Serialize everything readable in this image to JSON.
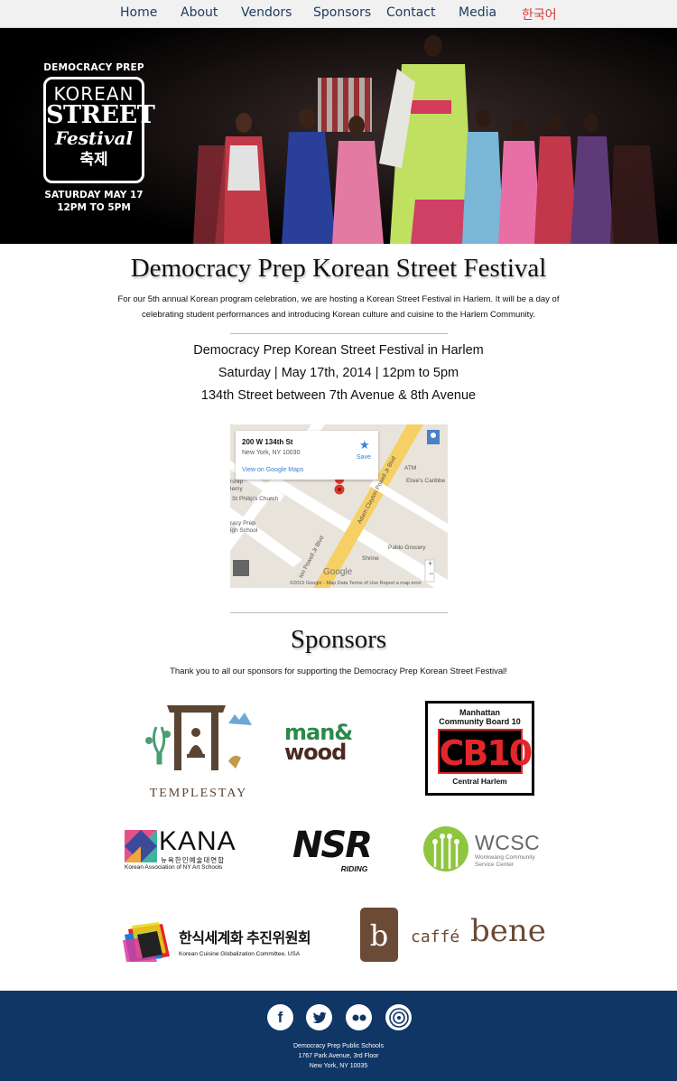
{
  "nav": {
    "items": [
      "Home",
      "About",
      "Vendors",
      "Sponsors",
      "Contact",
      "Media",
      "한국어"
    ]
  },
  "hero": {
    "logo_top": "DEMOCRACY PREP",
    "logo_line1": "KOREAN",
    "logo_line2": "STREET",
    "logo_line3": "Festival",
    "logo_line4": "축제",
    "logo_date": "SATURDAY  MAY  17",
    "logo_time": "12PM TO 5PM"
  },
  "main": {
    "title": "Democracy Prep Korean Street Festival",
    "intro": "For our 5th annual Korean program celebration, we are hosting a Korean Street Festival in Harlem. It will be a day of celebrating student performances and introducing Korean culture and cuisine to the Harlem Community.",
    "info_line1": "Democracy Prep Korean Street Festival in Harlem",
    "info_line2": "Saturday | May 17th, 2014 | 12pm to 5pm",
    "info_line3": "134th Street between 7th Avenue & 8th Avenue"
  },
  "map": {
    "address_line1": "200 W 134th St",
    "address_line2": "New York, NY 10030",
    "save_label": "Save",
    "view_link": "View on Google Maps",
    "labels": [
      "ATM",
      "Elsie's Caribbe",
      "rship",
      "lemy",
      "St Philip's Church",
      "racy Prep",
      "igh School",
      "Adam Clayton Powell Jr Blvd",
      "ton Powell Jr Blvd",
      "Pablo Grocery",
      "Shrine"
    ],
    "google": "Google",
    "footer": "©2015 Google · Map Data     Terms of Use     Report a map error"
  },
  "sponsors": {
    "title": "Sponsors",
    "text": "Thank you to all our sponsors for supporting the Democracy Prep Korean Street Festival!",
    "templestay": "TEMPLESTAY",
    "manwood_1": "man&",
    "manwood_2": "wood",
    "cb10_line1": "Manhattan",
    "cb10_line2": "Community Board 10",
    "cb10_mark": "CB10",
    "cb10_line3": "Central Harlem",
    "kana": "KANA",
    "kana_korean": "뉴욕한인예술대연합",
    "kana_sub": "Korean Association of NY Art Schools",
    "nsr": "NSR",
    "nsr_sub": "RIDING",
    "wcsc": "WCSC",
    "wcsc_sub1": "Wonkwang Community",
    "wcsc_sub2": "Service Center",
    "kcg_korean": "한식세계화 추진위원회",
    "kcg_sub": "Korean Cuisine Globalization Committee, USA",
    "caffe": "caffé",
    "bene": "bene",
    "bene_mark": "b"
  },
  "footer": {
    "social": [
      "facebook-icon",
      "twitter-icon",
      "flickr-icon",
      "dribbble-icon"
    ],
    "line1": "Democracy Prep Public Schools",
    "line2": "1767 Park Avenue, 3rd Floor",
    "line3": "New York, NY 10035"
  },
  "colors": {
    "nav_bg": "#f1f1f1",
    "nav_text": "#1e3a5f",
    "nav_korean": "#d63a3a",
    "footer_bg": "#0f3665"
  }
}
